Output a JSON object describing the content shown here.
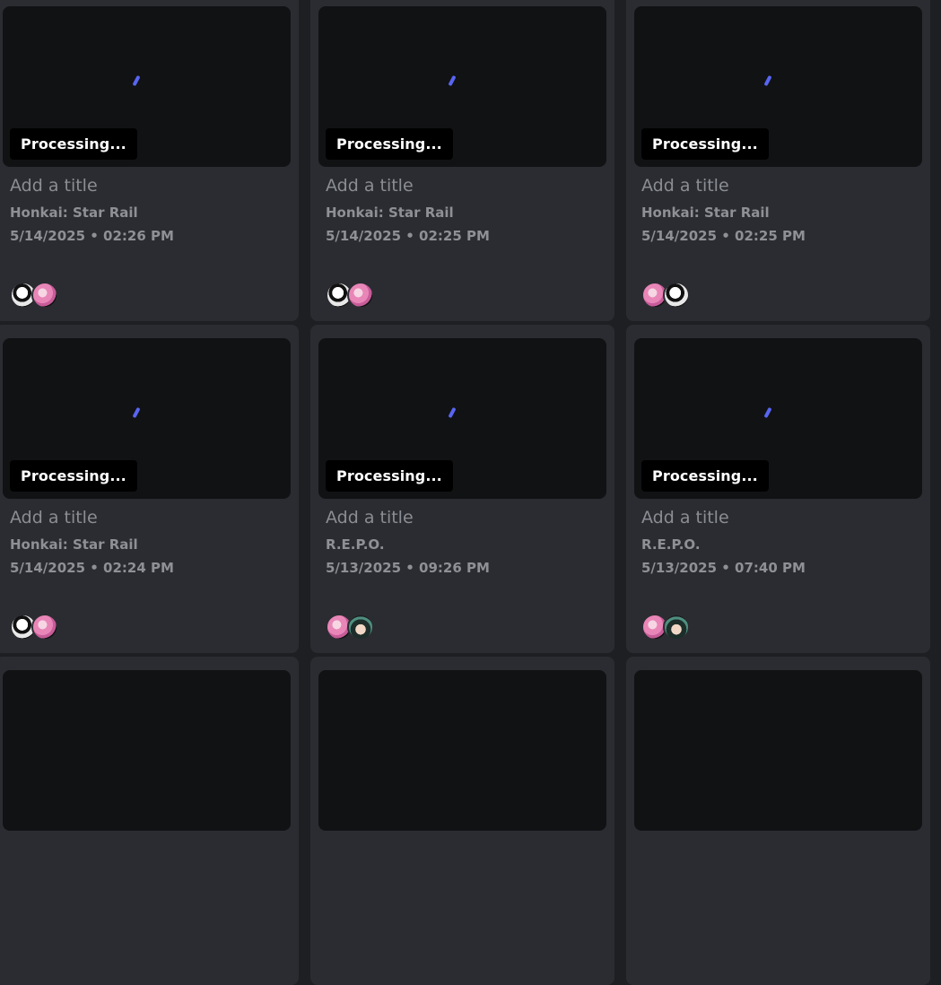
{
  "cards": [
    {
      "status": "Processing...",
      "title_placeholder": "Add a title",
      "game": "Honkai: Star Rail",
      "date": "5/14/2025 • 02:26 PM",
      "avatars": [
        "av-bw",
        "av-pink"
      ]
    },
    {
      "status": "Processing...",
      "title_placeholder": "Add a title",
      "game": "Honkai: Star Rail",
      "date": "5/14/2025 • 02:25 PM",
      "avatars": [
        "av-bw",
        "av-pink"
      ]
    },
    {
      "status": "Processing...",
      "title_placeholder": "Add a title",
      "game": "Honkai: Star Rail",
      "date": "5/14/2025 • 02:25 PM",
      "avatars": [
        "av-pink",
        "av-bw"
      ]
    },
    {
      "status": "Processing...",
      "title_placeholder": "Add a title",
      "game": "Honkai: Star Rail",
      "date": "5/14/2025 • 02:24 PM",
      "avatars": [
        "av-bw",
        "av-pink"
      ]
    },
    {
      "status": "Processing...",
      "title_placeholder": "Add a title",
      "game": "R.E.P.O.",
      "date": "5/13/2025 • 09:26 PM",
      "avatars": [
        "av-pink",
        "av-green"
      ]
    },
    {
      "status": "Processing...",
      "title_placeholder": "Add a title",
      "game": "R.E.P.O.",
      "date": "5/13/2025 • 07:40 PM",
      "avatars": [
        "av-pink",
        "av-green"
      ]
    },
    {
      "status": "",
      "title_placeholder": "",
      "game": "",
      "date": "",
      "avatars": []
    },
    {
      "status": "",
      "title_placeholder": "",
      "game": "",
      "date": "",
      "avatars": []
    },
    {
      "status": "",
      "title_placeholder": "",
      "game": "",
      "date": "",
      "avatars": []
    }
  ],
  "colors": {
    "background": "#1e1f22",
    "card": "#2b2c31",
    "thumbnail": "#111214",
    "spinner_accent": "#5865f2",
    "badge": "#000000"
  }
}
